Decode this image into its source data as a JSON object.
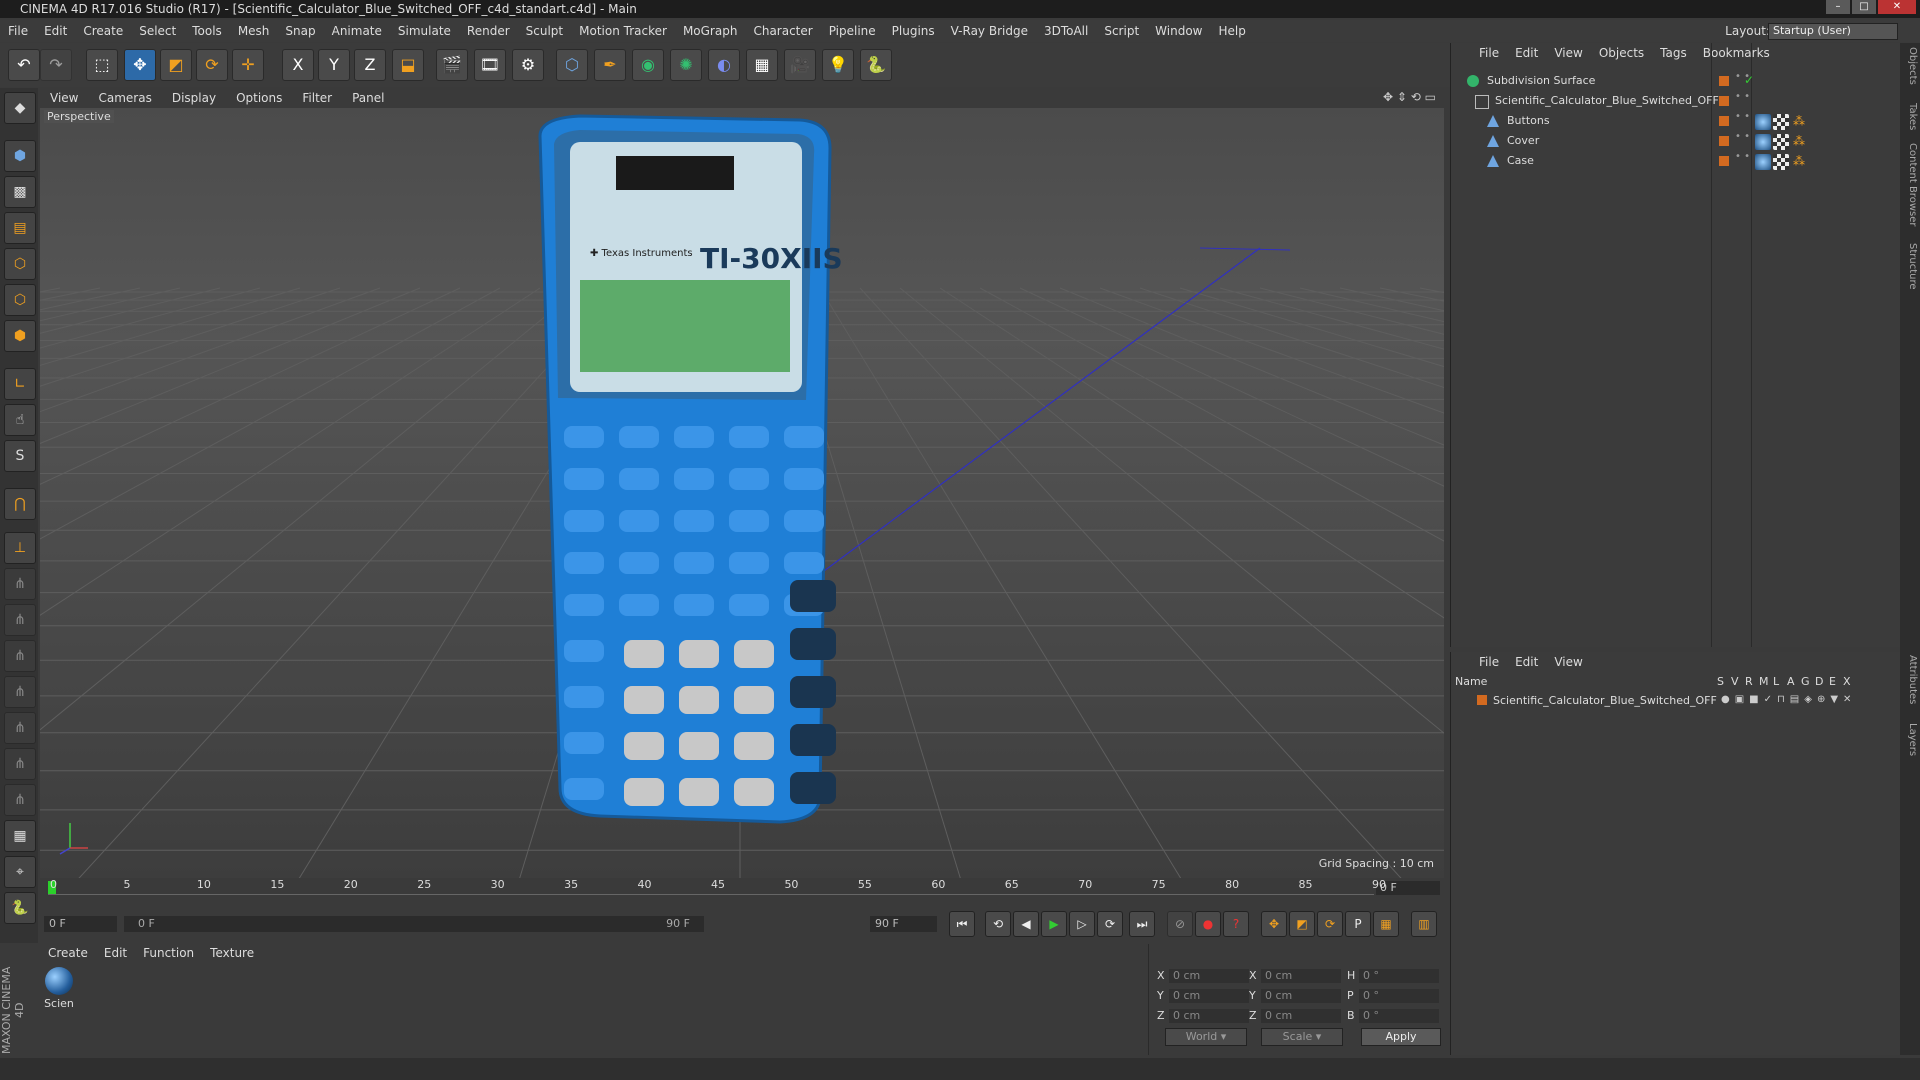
{
  "window": {
    "title": "CINEMA 4D R17.016 Studio (R17) - [Scientific_Calculator_Blue_Switched_OFF_c4d_standart.c4d] - Main"
  },
  "menubar": {
    "items": [
      "File",
      "Edit",
      "Create",
      "Select",
      "Tools",
      "Mesh",
      "Snap",
      "Animate",
      "Simulate",
      "Render",
      "Sculpt",
      "Motion Tracker",
      "MoGraph",
      "Character",
      "Pipeline",
      "Plugins",
      "V-Ray Bridge",
      "3DToAll",
      "Script",
      "Window",
      "Help"
    ],
    "layout_label": "Layout:",
    "layout_value": "Startup (User)"
  },
  "toolbar": {
    "axis_x": "X",
    "axis_y": "Y",
    "axis_z": "Z"
  },
  "lefttools": {
    "snap_label": "S"
  },
  "viewport": {
    "menu": [
      "View",
      "Cameras",
      "Display",
      "Options",
      "Filter",
      "Panel"
    ],
    "camera": "Perspective",
    "grid_spacing": "Grid Spacing : 10 cm"
  },
  "calculator": {
    "model": "TI-30XIIS"
  },
  "timeline": {
    "ticks": [
      "0",
      "5",
      "10",
      "15",
      "20",
      "25",
      "30",
      "35",
      "40",
      "45",
      "50",
      "55",
      "60",
      "65",
      "70",
      "75",
      "80",
      "85",
      "90"
    ],
    "current_frame": "0 F"
  },
  "transport": {
    "start": "0 F",
    "range_start": "0 F",
    "range_end": "90 F",
    "end": "90 F"
  },
  "material": {
    "menu": [
      "Create",
      "Edit",
      "Function",
      "Texture"
    ],
    "items": [
      {
        "name": "Scien"
      }
    ]
  },
  "coords": {
    "rows": [
      {
        "l1": "X",
        "v1": "0 cm",
        "l2": "X",
        "v2": "0 cm",
        "l3": "H",
        "v3": "0 °"
      },
      {
        "l1": "Y",
        "v1": "0 cm",
        "l2": "Y",
        "v2": "0 cm",
        "l3": "P",
        "v3": "0 °"
      },
      {
        "l1": "Z",
        "v1": "0 cm",
        "l2": "Z",
        "v2": "0 cm",
        "l3": "B",
        "v3": "0 °"
      }
    ],
    "world": "World",
    "scale": "Scale",
    "apply": "Apply"
  },
  "objects": {
    "menu": [
      "File",
      "Edit",
      "View",
      "Objects",
      "Tags",
      "Bookmarks"
    ],
    "tree": [
      {
        "name": "Subdivision Surface",
        "type": "subdiv"
      },
      {
        "name": "Scientific_Calculator_Blue_Switched_OFF",
        "type": "null"
      },
      {
        "name": "Buttons",
        "type": "poly"
      },
      {
        "name": "Cover",
        "type": "poly"
      },
      {
        "name": "Case",
        "type": "poly"
      }
    ]
  },
  "layers": {
    "menu": [
      "File",
      "Edit",
      "View"
    ],
    "columns": [
      "Name",
      "S",
      "V",
      "R",
      "M",
      "L",
      "A",
      "G",
      "D",
      "E",
      "X"
    ],
    "rows": [
      {
        "name": "Scientific_Calculator_Blue_Switched_OFF"
      }
    ]
  },
  "sidetabs": [
    "Objects",
    "Takes",
    "Content Browser",
    "Structure",
    "Attributes",
    "Layers"
  ],
  "branding": {
    "text": "MAXON CINEMA 4D"
  },
  "colors": {
    "accent": "#2d6aa8",
    "layer_orange": "#d36a20",
    "calc_blue": "#1f7fd6"
  }
}
